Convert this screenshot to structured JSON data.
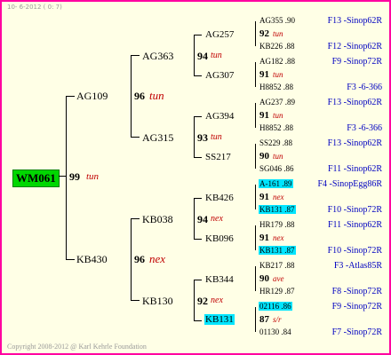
{
  "header_text": "10- 6-2012 ( 0: 7)",
  "footer": "Copyright 2008-2012 @ Karl Kehrle Foundation",
  "root": {
    "name": "WM061",
    "score": "99",
    "tag": "tun"
  },
  "gen1": [
    {
      "name": "AG109",
      "score": "96",
      "tag": "tun"
    },
    {
      "name": "KB430",
      "score": "96",
      "tag": "nex"
    }
  ],
  "gen2": [
    {
      "name": "AG363",
      "score": "94",
      "tag": "tun"
    },
    {
      "name": "AG315",
      "score": "93",
      "tag": "tun"
    },
    {
      "name": "KB038",
      "score": "94",
      "tag": "nex"
    },
    {
      "name": "KB130",
      "score": "92",
      "tag": "nex"
    }
  ],
  "gen3": [
    {
      "name": "AG257"
    },
    {
      "name": "AG307"
    },
    {
      "name": "AG394"
    },
    {
      "name": "SS217"
    },
    {
      "name": "KB426"
    },
    {
      "name": "KB096"
    },
    {
      "name": "KB344"
    },
    {
      "name": "KB131"
    }
  ],
  "leaves": [
    {
      "a": "AG355 .90",
      "mid": "92",
      "tag": "tun",
      "b": "KB226 .88",
      "ra": "F13 -Sinop62R",
      "rb": "F12 -Sinop62R"
    },
    {
      "a": "AG182 .88",
      "mid": "91",
      "tag": "tun",
      "b": "H8852 .88",
      "ra": "F9 -Sinop72R",
      "rb": "F3 -6-366"
    },
    {
      "a": "AG237 .89",
      "mid": "91",
      "tag": "tun",
      "b": "H8852 .88",
      "ra": "F13 -Sinop62R",
      "rb": "F3 -6-366"
    },
    {
      "a": "SS229 .88",
      "mid": "90",
      "tag": "tun",
      "b": "SG046 .86",
      "ra": "F13 -Sinop62R",
      "rb": "F11 -Sinop62R"
    },
    {
      "a": "A-161 .89",
      "mid": "91",
      "tag": "nex",
      "b": "KB131 .87",
      "ra": "F4 -SinopEgg86R",
      "rb": "F10 -Sinop72R"
    },
    {
      "a": "HR179 .88",
      "mid": "91",
      "tag": "nex",
      "b": "KB131 .87",
      "ra": "F11 -Sinop62R",
      "rb": "F10 -Sinop72R"
    },
    {
      "a": "KB217 .88",
      "mid": "90",
      "tag": "ave",
      "b": "HR129 .87",
      "ra": "F3 -Atlas85R",
      "rb": "F8 -Sinop72R"
    },
    {
      "a": "02116 .86",
      "mid": "87",
      "tag": "s/r",
      "b": "01130 .84",
      "ra": "F9 -Sinop72R",
      "rb": "F7 -Sinop72R"
    }
  ]
}
